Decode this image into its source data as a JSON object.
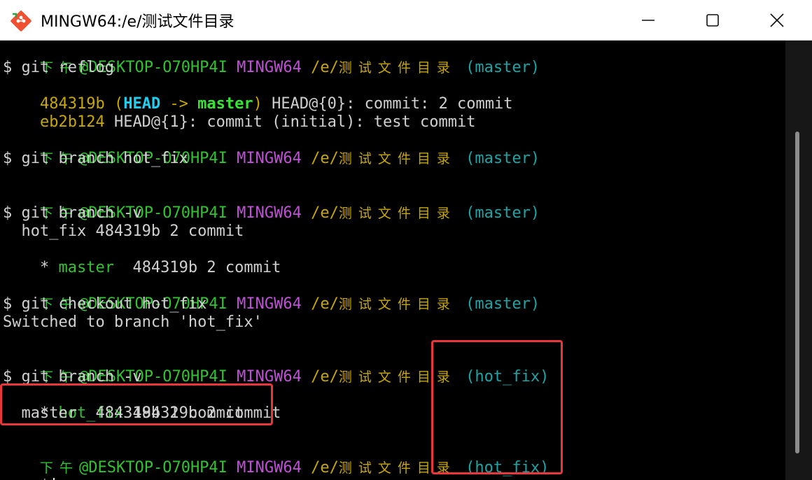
{
  "window": {
    "title": "MINGW64:/e/测试文件目录",
    "minimize_icon": "minimize-icon",
    "maximize_icon": "maximize-icon",
    "close_icon": "close-icon"
  },
  "colors": {
    "green": "#33c233",
    "purple": "#c051d6",
    "yellow": "#c8a800",
    "cyan": "#1aa6a6",
    "highlight": "#e8363a"
  },
  "prompt": {
    "time": "下午",
    "user_host": "@DESKTOP-O70HP4I",
    "system": "MINGW64",
    "path": "/e/",
    "dir": "测试文件目录",
    "branch_master": "(master)",
    "branch_hot_fix": "(hot_fix)",
    "symbol": "$"
  },
  "lines": {
    "cmd_reflog": "$ git reflog",
    "reflog_1_hash": "484319b",
    "reflog_1_open": "(",
    "reflog_1_head": "HEAD",
    "reflog_1_arrow": " -> ",
    "reflog_1_master": "master",
    "reflog_1_close": ")",
    "reflog_1_rest": " HEAD@{0}: commit: 2 commit",
    "reflog_2_hash": "eb2b124",
    "reflog_2_rest": " HEAD@{1}: commit (initial): test commit",
    "cmd_branch_hot_fix": "$ git branch hot_fix",
    "cmd_branch_v": "$ git branch -v",
    "list1_row1": "  hot_fix 484319b 2 commit",
    "list1_row2_star": "* ",
    "list1_row2_name": "master ",
    "list1_row2_rest": " 484319b 2 commit",
    "cmd_checkout": "$ git checkout hot_fix",
    "switched": "Switched to branch 'hot_fix'",
    "list2_row1_star": "* ",
    "list2_row1_name": "hot_fix",
    "list2_row1_rest": " 484319b 2 commit",
    "list2_row2": "  master  484319b 2 commit",
    "final_prompt": "$"
  }
}
